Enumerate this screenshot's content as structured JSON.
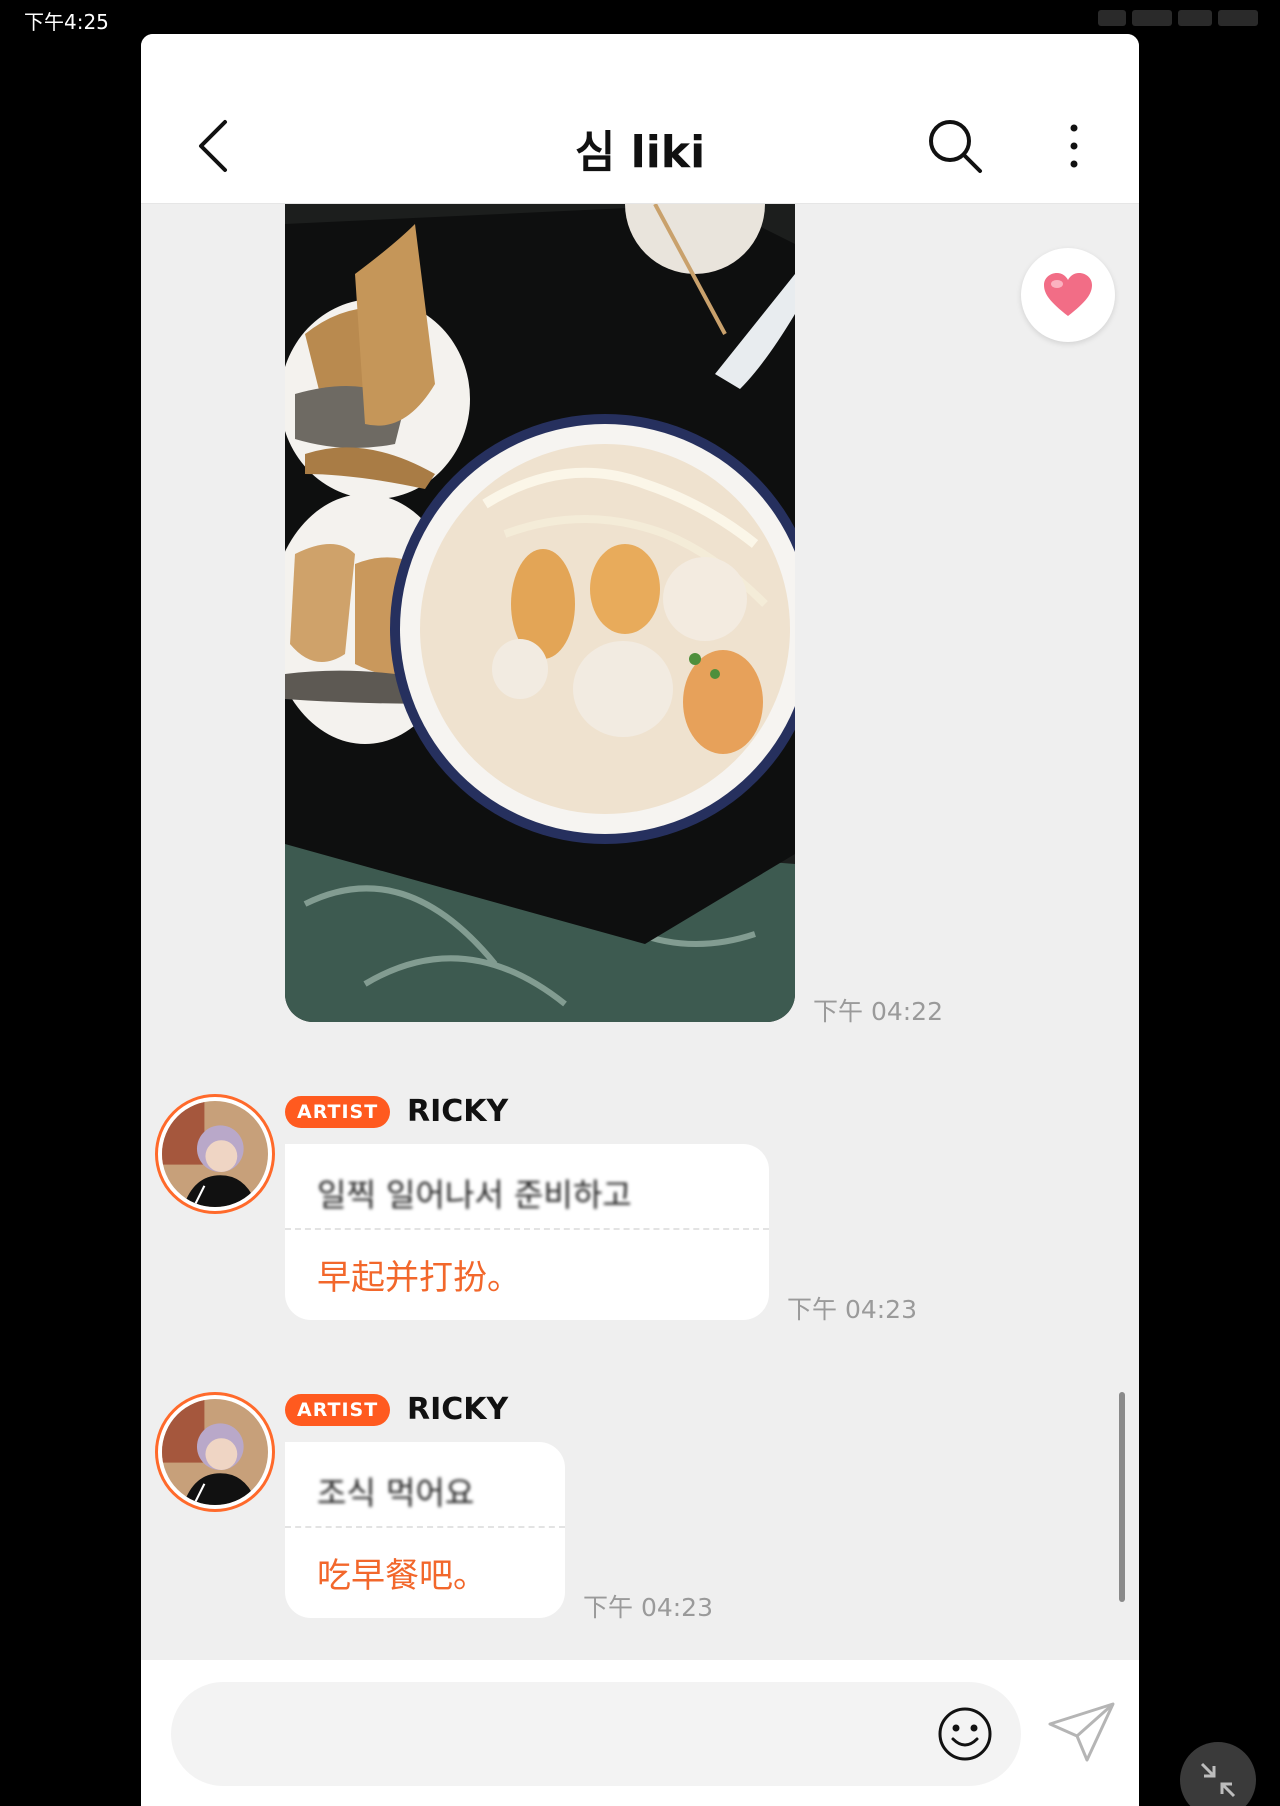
{
  "status_bar": {
    "time": "下午4:25"
  },
  "header": {
    "title": "심 liki",
    "back_icon": "chevron-left-icon",
    "search_icon": "search-icon",
    "more_icon": "more-vertical-icon"
  },
  "messages": [
    {
      "type": "image",
      "description_icon": "food-photo",
      "time": "下午 04:22"
    },
    {
      "type": "text",
      "badge": "ARTIST",
      "sender": "RICKY",
      "original": "일찍 일어나서 준비하고",
      "translation": "早起并打扮。",
      "time": "下午 04:23"
    },
    {
      "type": "text",
      "badge": "ARTIST",
      "sender": "RICKY",
      "original": "조식 먹어요",
      "translation": "吃早餐吧。",
      "time": "下午 04:23"
    }
  ],
  "reaction": {
    "icon": "heart-icon"
  },
  "composer": {
    "placeholder": "",
    "emoji_icon": "smiley-icon",
    "send_icon": "paper-plane-icon"
  },
  "colors": {
    "accent": "#ff5a1f",
    "translation": "#f2672b",
    "timestamp": "#9a9a9a"
  }
}
